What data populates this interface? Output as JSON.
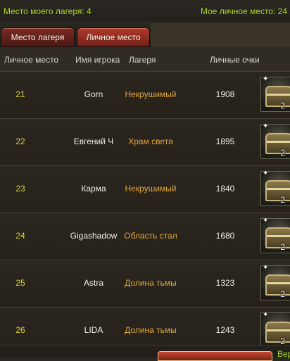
{
  "status": {
    "camp_place": "Место моего лагеря: 4",
    "personal_place": "Мое личное место: 24"
  },
  "tabs": [
    {
      "label": "Место лагеря",
      "active": false
    },
    {
      "label": "Личное место",
      "active": true
    }
  ],
  "columns": {
    "rank": "Личное место",
    "player": "Имя игрока",
    "camp": "Лагеря",
    "points": "Личные очки"
  },
  "rows": [
    {
      "rank": "21",
      "name": "Gorn",
      "camp": "Некрушимый",
      "points": "1908",
      "reward_qty": "2",
      "reward_icon": "chest-icon"
    },
    {
      "rank": "22",
      "name": "Евгений Ч",
      "camp": "Храм света",
      "points": "1895",
      "reward_qty": "2",
      "reward_icon": "chest-icon"
    },
    {
      "rank": "23",
      "name": "Карма",
      "camp": "Некрушимый",
      "points": "1840",
      "reward_qty": "2",
      "reward_icon": "chest-icon"
    },
    {
      "rank": "24",
      "name": "Gigashadow",
      "camp": "Область стал",
      "points": "1680",
      "reward_qty": "2",
      "reward_icon": "chest-icon"
    },
    {
      "rank": "25",
      "name": "Astra",
      "camp": "Долина тьмы",
      "points": "1323",
      "reward_qty": "2",
      "reward_icon": "chest-icon"
    },
    {
      "rank": "26",
      "name": "LIDA",
      "camp": "Долина тьмы",
      "points": "1243",
      "reward_qty": "2",
      "reward_icon": "chest-icon"
    }
  ],
  "footer": {
    "link": "Вер"
  },
  "colors": {
    "status_text": "#a6d81f",
    "rank_text": "#d8d23a",
    "camp_text": "#e2a63d",
    "tab_active": "#b23a2c"
  }
}
